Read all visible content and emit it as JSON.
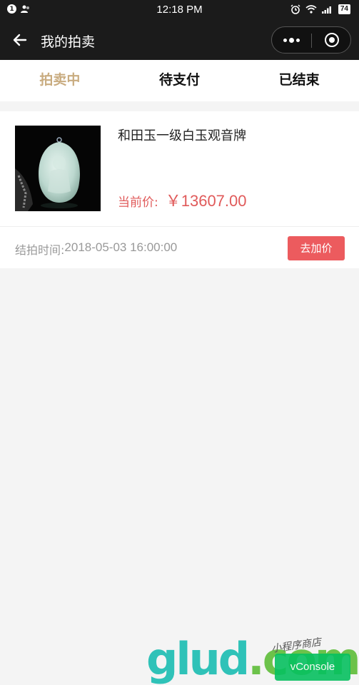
{
  "status_bar": {
    "notification_badge": "1",
    "time": "12:18 PM",
    "battery": "74"
  },
  "nav": {
    "title": "我的拍卖"
  },
  "tabs": [
    {
      "label": "拍卖中",
      "active": true
    },
    {
      "label": "待支付",
      "active": false
    },
    {
      "label": "已结束",
      "active": false
    }
  ],
  "auction_item": {
    "title": "和田玉一级白玉观音牌",
    "price_label": "当前价:",
    "price_value": "￥13607.00",
    "end_time_label": "结拍时间:",
    "end_time_value": "2018-05-03 16:00:00",
    "bid_button": "去加价"
  },
  "watermark": {
    "brand": "glud",
    "domain": ".com",
    "tagline": "小程序商店"
  },
  "vconsole": {
    "label": "vConsole"
  },
  "colors": {
    "nav_bg": "#1b1b1b",
    "tab_active": "#c9ac80",
    "price": "#e05a5a",
    "bid_button": "#ec5b5e",
    "vconsole": "#07c160"
  }
}
